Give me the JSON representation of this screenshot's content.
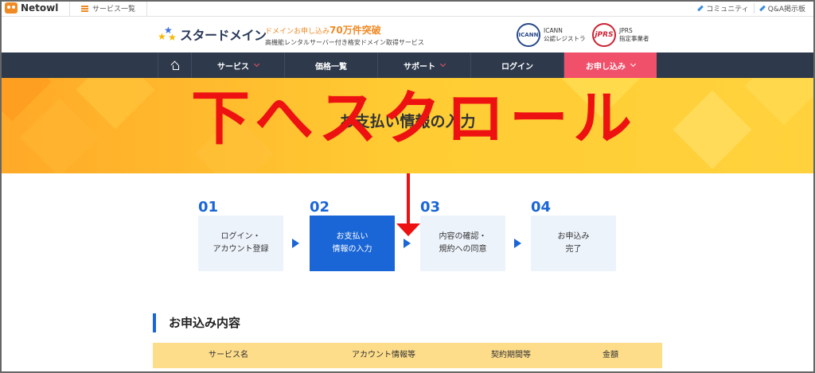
{
  "topbar": {
    "brand": "Netowl",
    "service_list": "サービス一覧",
    "links": [
      "コミュニティ",
      "Q&A掲示板"
    ]
  },
  "header": {
    "logo_name": "スタードメイン",
    "tagline_prefix": "ドメインお申し込み",
    "tagline_highlight": "70万件突破",
    "tagline_sub": "高機能レンタルサーバー付き格安ドメイン取得サービス",
    "icann_logo": "ICANN",
    "icann_line1": "ICANN",
    "icann_line2": "公認レジストラ",
    "jprs_logo": "jPRS",
    "jprs_line1": "JPRS",
    "jprs_line2": "指定事業者"
  },
  "nav": {
    "items": [
      {
        "label": "",
        "icon": "home-icon",
        "has_chevron": false
      },
      {
        "label": "サービス",
        "has_chevron": true
      },
      {
        "label": "価格一覧",
        "has_chevron": false
      },
      {
        "label": "サポート",
        "has_chevron": true
      },
      {
        "label": "ログイン",
        "has_chevron": false
      },
      {
        "label": "お申し込み",
        "has_chevron": true,
        "highlight": true
      }
    ]
  },
  "banner": {
    "title": "お支払い情報の入力"
  },
  "overlay": {
    "text": "下へスクロール",
    "color": "#ee1111"
  },
  "steps": [
    {
      "number": "01",
      "label": "ログイン・\nアカウント登録",
      "active": false
    },
    {
      "number": "02",
      "label": "お支払い\n情報の入力",
      "active": true
    },
    {
      "number": "03",
      "label": "内容の確認・\n規約への同意",
      "active": false
    },
    {
      "number": "04",
      "label": "お申込み\n完了",
      "active": false
    }
  ],
  "section": {
    "title": "お申込み内容",
    "columns": [
      "サービス名",
      "アカウント情報等",
      "契約期間等",
      "金額"
    ]
  },
  "colors": {
    "accent": "#1a66d6",
    "nav_bg": "#2e3a4c",
    "cta": "#f0506a",
    "table_header": "#fddc8a"
  }
}
